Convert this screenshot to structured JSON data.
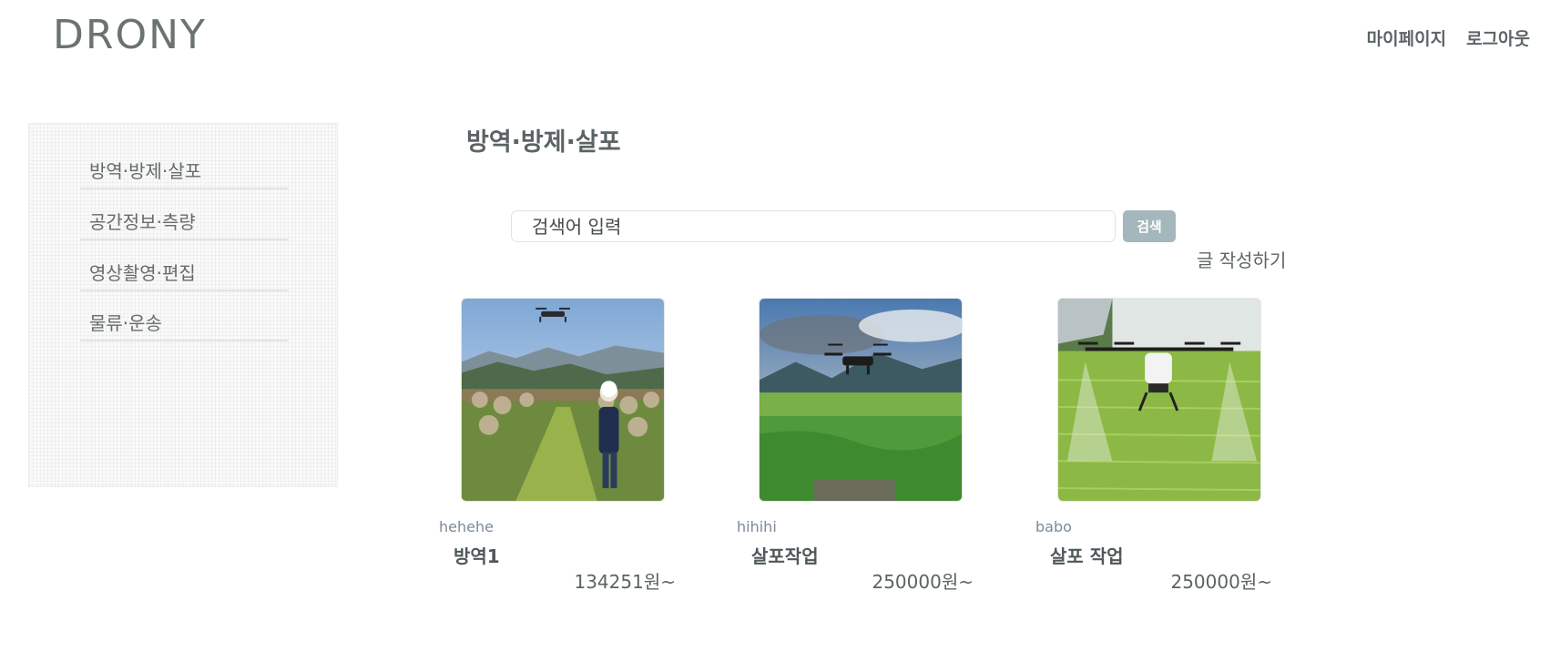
{
  "header": {
    "logo": "DRONY",
    "nav": [
      {
        "label": "마이페이지"
      },
      {
        "label": "로그아웃"
      }
    ]
  },
  "sidebar": {
    "items": [
      {
        "label": "방역·방제·살포"
      },
      {
        "label": "공간정보·측량"
      },
      {
        "label": "영상촬영·편집"
      },
      {
        "label": "물류·운송"
      }
    ]
  },
  "main": {
    "title": "방역·방제·살포",
    "search": {
      "placeholder": "검색어 입력",
      "button_label": "검색"
    },
    "write_label": "글 작성하기",
    "cards": [
      {
        "author": "hehehe",
        "title": "방역1",
        "price": "134251원~",
        "image_icon": "drone-orchard-photo"
      },
      {
        "author": "hihihi",
        "title": "살포작업",
        "price": "250000원~",
        "image_icon": "drone-field-photo"
      },
      {
        "author": "babo",
        "title": "살포 작업",
        "price": "250000원~",
        "image_icon": "drone-spraying-photo"
      }
    ]
  },
  "colors": {
    "accent": "#a3b7bd",
    "text": "#5b6365",
    "author": "#7b8a9a"
  }
}
